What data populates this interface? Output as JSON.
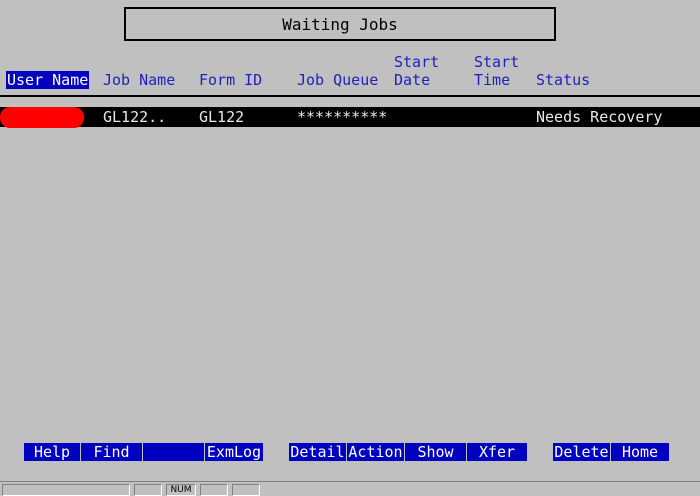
{
  "title": "Waiting Jobs",
  "columns": {
    "user_name": "User Name",
    "job_name": "Job Name",
    "form_id": "Form ID",
    "job_queue": "Job Queue",
    "start_date_1": "Start",
    "start_date_2": "Date",
    "start_time_1": "Start",
    "start_time_2": "Time",
    "status": "Status"
  },
  "rows": [
    {
      "user_name": "",
      "job_name": "GL122..",
      "form_id": "GL122",
      "job_queue": "**********",
      "start_date": "",
      "start_time": "",
      "status": "Needs Recovery"
    }
  ],
  "function_keys_left": [
    "Help",
    "Find",
    "",
    "ExmLog"
  ],
  "function_keys_mid": [
    "Detail",
    "Action",
    "Show",
    "Xfer"
  ],
  "function_keys_right": [
    "Delete",
    "Home"
  ],
  "status_bar": {
    "num": "NUM"
  },
  "colors": {
    "background": "#c0c0c0",
    "header_text": "#1f1fbf",
    "selected_bg": "#0000c0",
    "row_bg": "#000000",
    "redaction": "#ff0000"
  }
}
